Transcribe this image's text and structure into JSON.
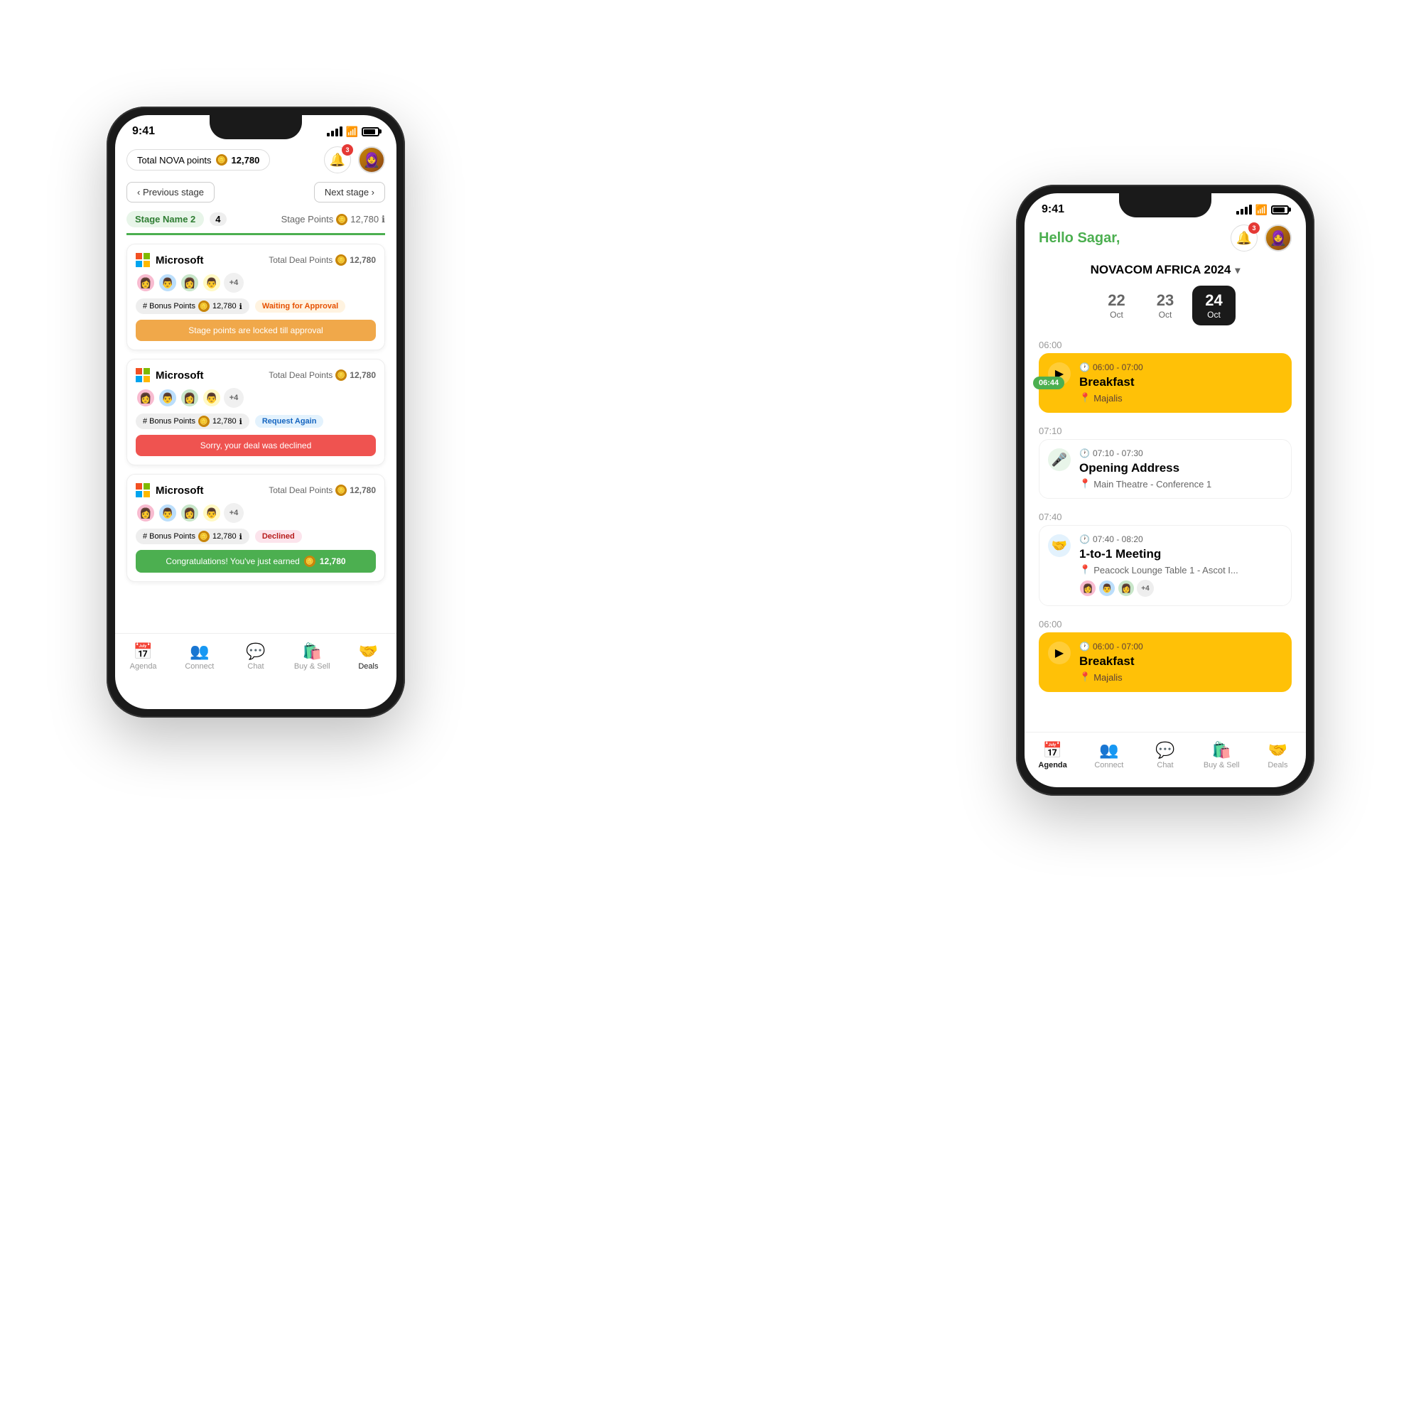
{
  "phone1": {
    "status_time": "9:41",
    "header": {
      "nova_label": "Total NOVA points",
      "points_value": "12,780",
      "notif_count": "3"
    },
    "navigation": {
      "prev_label": "‹ Previous stage",
      "next_label": "Next stage ›"
    },
    "stage": {
      "name": "Stage Name 2",
      "count": "4",
      "points_label": "Stage Points",
      "points_value": "12,780"
    },
    "deals": [
      {
        "company": "Microsoft",
        "total_label": "Total Deal Points",
        "total_value": "12,780",
        "bonus_label": "# Bonus Points",
        "bonus_value": "12,780",
        "status": "Waiting for Approval",
        "status_type": "waiting",
        "bar_text": "Stage points are locked till approval",
        "bar_type": "locked",
        "avatars": [
          "👩",
          "👨",
          "👩",
          "👨"
        ],
        "more": "+4"
      },
      {
        "company": "Microsoft",
        "total_label": "Total Deal Points",
        "total_value": "12,780",
        "bonus_label": "# Bonus Points",
        "bonus_value": "12,780",
        "status": "Request Again",
        "status_type": "request",
        "bar_text": "Sorry, your deal was declined",
        "bar_type": "declined",
        "avatars": [
          "👩",
          "👨",
          "👩",
          "👨"
        ],
        "more": "+4"
      },
      {
        "company": "Microsoft",
        "total_label": "Total Deal Points",
        "total_value": "12,780",
        "bonus_label": "# Bonus Points",
        "bonus_value": "12,780",
        "status": "Declined",
        "status_type": "declined",
        "bar_text": "Congratulations! You've just earned",
        "bar_points": "12,780",
        "bar_type": "congrats",
        "avatars": [
          "👩",
          "👨",
          "👩",
          "👨"
        ],
        "more": "+4"
      }
    ],
    "bottom_nav": [
      {
        "icon": "📅",
        "label": "Agenda",
        "active": false
      },
      {
        "icon": "👥",
        "label": "Connect",
        "active": false
      },
      {
        "icon": "💬",
        "label": "Chat",
        "active": false
      },
      {
        "icon": "🛍️",
        "label": "Buy & Sell",
        "active": false
      },
      {
        "icon": "🤝",
        "label": "Deals",
        "active": true
      }
    ]
  },
  "phone2": {
    "status_time": "9:41",
    "header": {
      "hello_text": "Hello Sagar,",
      "notif_count": "3"
    },
    "event_name": "NOVACOM AFRICA 2024",
    "dates": [
      {
        "day": "22",
        "month": "Oct",
        "active": false
      },
      {
        "day": "23",
        "month": "Oct",
        "active": false
      },
      {
        "day": "24",
        "month": "Oct",
        "active": true
      }
    ],
    "agenda": [
      {
        "time_label": "",
        "events": [
          {
            "title": "Breakfast",
            "time": "06:00 - 07:00",
            "location": "Majalis",
            "icon": "▶",
            "icon_bg": "#ffc107",
            "type": "highlight",
            "current_time": "06:44"
          }
        ]
      },
      {
        "time_label": "07:10",
        "events": [
          {
            "title": "Opening Address",
            "time": "07:10 - 07:30",
            "location": "Main Theatre - Conference 1",
            "icon": "🎤",
            "icon_bg": "#e8f5e9",
            "type": "normal"
          }
        ]
      },
      {
        "time_label": "07:40",
        "events": [
          {
            "title": "1-to-1 Meeting",
            "time": "07:40 - 08:20",
            "location": "Peacock Lounge Table 1 - Ascot I...",
            "icon": "🤝",
            "icon_bg": "#e3f2fd",
            "type": "normal",
            "has_avatars": true,
            "avatars": [
              "👩",
              "👨",
              "👩"
            ],
            "more": "+4"
          }
        ]
      },
      {
        "time_label": "06:00",
        "events": [
          {
            "title": "Breakfast",
            "time": "06:00 - 07:00",
            "location": "Majalis",
            "icon": "▶",
            "icon_bg": "#ffc107",
            "type": "highlight2"
          }
        ]
      }
    ],
    "bottom_nav": [
      {
        "icon": "📅",
        "label": "Agenda",
        "active": true
      },
      {
        "icon": "👥",
        "label": "Connect",
        "active": false
      },
      {
        "icon": "💬",
        "label": "Chat",
        "active": false
      },
      {
        "icon": "🛍️",
        "label": "Buy & Sell",
        "active": false
      },
      {
        "icon": "🤝",
        "label": "Deals",
        "active": false
      }
    ]
  }
}
